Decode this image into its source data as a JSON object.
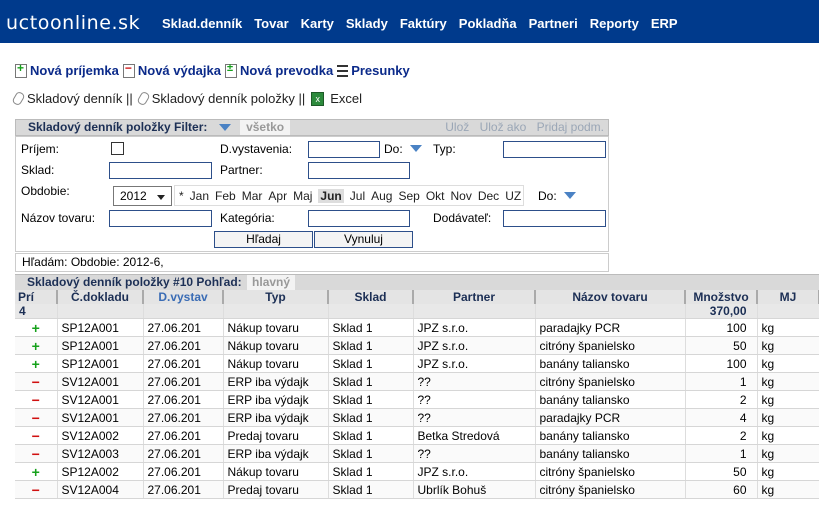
{
  "app": {
    "logo": "uctoonline.sk"
  },
  "nav": [
    "Sklad.denník",
    "Tovar",
    "Karty",
    "Sklady",
    "Faktúry",
    "Pokladňa",
    "Partneri",
    "Reporty",
    "ERP"
  ],
  "actions": {
    "new_receipt": "Nová príjemka",
    "new_issue": "Nová výdajka",
    "new_transfer": "Nová prevodka",
    "transfers": "Presunky",
    "journal": "Skladový denník ||",
    "journal_items": "Skladový denník položky ||",
    "excel": "Excel"
  },
  "filter": {
    "title": "Skladový denník položky Filter:",
    "all": "všetko",
    "save": "Ulož",
    "save_as": "Ulož ako",
    "add_cond": "Pridaj podm.",
    "prijem_label": "Príjem:",
    "date_label": "D.vystavenia:",
    "to_label": "Do:",
    "type_label": "Typ:",
    "warehouse_label": "Sklad:",
    "partner_label": "Partner:",
    "period_label": "Obdobie:",
    "period_to_label": "Do:",
    "year": "2012",
    "months": [
      "*",
      "Jan",
      "Feb",
      "Mar",
      "Apr",
      "Maj",
      "Jun",
      "Jul",
      "Aug",
      "Sep",
      "Okt",
      "Nov",
      "Dec",
      "UZ"
    ],
    "selected_month": "Jun",
    "product_label": "Názov tovaru:",
    "category_label": "Kategória:",
    "supplier_label": "Dodávateľ:",
    "search_btn": "Hľadaj",
    "reset_btn": "Vynuluj"
  },
  "search_status": "Hľadám: Obdobie: 2012-6,",
  "grid": {
    "title": "Skladový denník položky #10 Pohľad:",
    "view": "hlavný",
    "columns": [
      "Prí",
      "Č.dokladu",
      "D.vystav",
      "Typ",
      "Sklad",
      "Partner",
      "Názov tovaru",
      "Množstvo",
      "MJ"
    ],
    "summary": {
      "count": "4",
      "quantity": "370,00"
    },
    "rows": [
      {
        "sign": "+",
        "doc": "SP12A001",
        "date": "27.06.201",
        "type": "Nákup tovaru",
        "wh": "Sklad 1",
        "partner": "JPZ s.r.o.",
        "product": "paradajky PCR",
        "qty": "100",
        "unit": "kg"
      },
      {
        "sign": "+",
        "doc": "SP12A001",
        "date": "27.06.201",
        "type": "Nákup tovaru",
        "wh": "Sklad 1",
        "partner": "JPZ s.r.o.",
        "product": "citróny španielsko",
        "qty": "50",
        "unit": "kg"
      },
      {
        "sign": "+",
        "doc": "SP12A001",
        "date": "27.06.201",
        "type": "Nákup tovaru",
        "wh": "Sklad 1",
        "partner": "JPZ s.r.o.",
        "product": "banány taliansko",
        "qty": "100",
        "unit": "kg"
      },
      {
        "sign": "−",
        "doc": "SV12A001",
        "date": "27.06.201",
        "type": "ERP iba výdajk",
        "wh": "Sklad 1",
        "partner": "??",
        "product": "citróny španielsko",
        "qty": "1",
        "unit": "kg"
      },
      {
        "sign": "−",
        "doc": "SV12A001",
        "date": "27.06.201",
        "type": "ERP iba výdajk",
        "wh": "Sklad 1",
        "partner": "??",
        "product": "banány taliansko",
        "qty": "2",
        "unit": "kg"
      },
      {
        "sign": "−",
        "doc": "SV12A001",
        "date": "27.06.201",
        "type": "ERP iba výdajk",
        "wh": "Sklad 1",
        "partner": "??",
        "product": "paradajky PCR",
        "qty": "4",
        "unit": "kg"
      },
      {
        "sign": "−",
        "doc": "SV12A002",
        "date": "27.06.201",
        "type": "Predaj tovaru",
        "wh": "Sklad 1",
        "partner": "Betka Stredová",
        "product": "banány taliansko",
        "qty": "2",
        "unit": "kg"
      },
      {
        "sign": "−",
        "doc": "SV12A003",
        "date": "27.06.201",
        "type": "ERP iba výdajk",
        "wh": "Sklad 1",
        "partner": "??",
        "product": "banány taliansko",
        "qty": "1",
        "unit": "kg"
      },
      {
        "sign": "+",
        "doc": "SP12A002",
        "date": "27.06.201",
        "type": "Nákup tovaru",
        "wh": "Sklad 1",
        "partner": "JPZ s.r.o.",
        "product": "citróny španielsko",
        "qty": "50",
        "unit": "kg"
      },
      {
        "sign": "−",
        "doc": "SV12A004",
        "date": "27.06.201",
        "type": "Predaj tovaru",
        "wh": "Sklad 1",
        "partner": "Ubrlík Bohuš",
        "product": "citróny španielsko",
        "qty": "60",
        "unit": "kg"
      }
    ]
  }
}
